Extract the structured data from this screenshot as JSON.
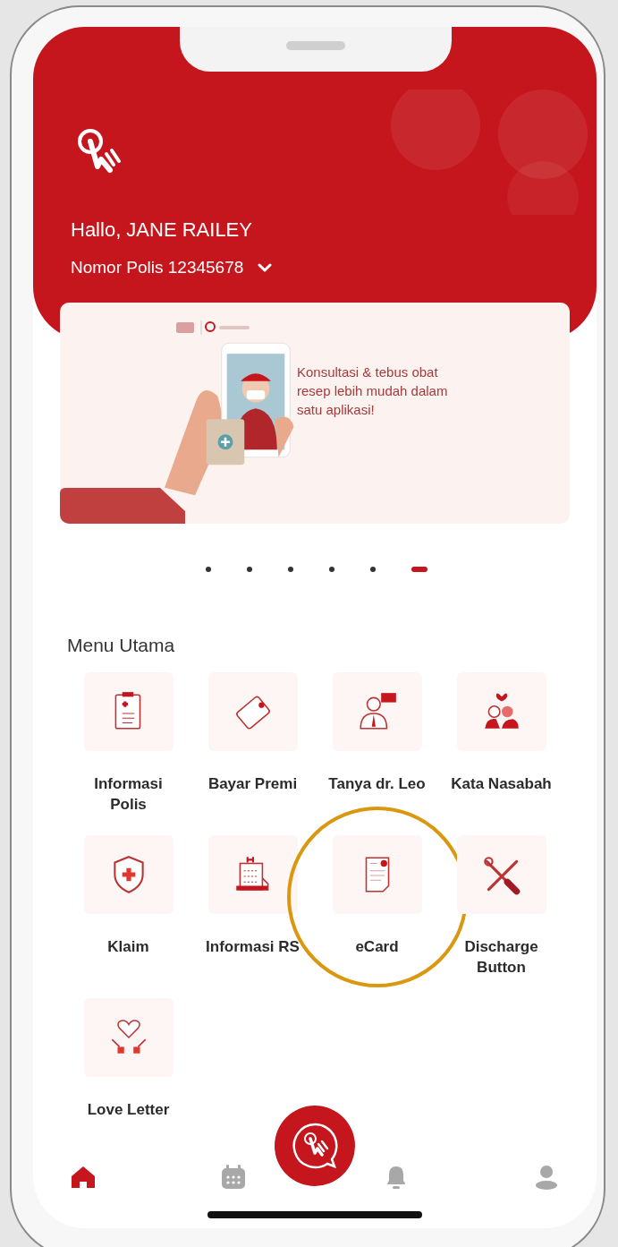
{
  "header": {
    "greeting": "Hallo, JANE RAILEY",
    "policy": "Nomor Polis 12345678"
  },
  "banner": {
    "headline": "Konsultasi & tebus obat resep lebih mudah dalam satu aplikasi!"
  },
  "carousel": {
    "dots": [
      {
        "selected": false
      },
      {
        "selected": false
      },
      {
        "selected": false
      },
      {
        "selected": false
      },
      {
        "selected": false
      },
      {
        "selected": true
      }
    ]
  },
  "menu": {
    "title": "Menu Utama",
    "items": [
      {
        "label": "Informasi Polis",
        "highlighted": false
      },
      {
        "label": "Bayar Premi",
        "highlighted": false
      },
      {
        "label": "Tanya dr. Leo",
        "highlighted": false
      },
      {
        "label": "Kata Nasabah",
        "highlighted": false
      },
      {
        "label": "Klaim",
        "highlighted": false
      },
      {
        "label": "Informasi RS",
        "highlighted": false
      },
      {
        "label": "eCard",
        "highlighted": true
      },
      {
        "label": "Discharge Button",
        "highlighted": false
      },
      {
        "label": "Love Letter",
        "highlighted": false
      }
    ]
  },
  "bottom_nav": [
    {
      "selected": true
    },
    {
      "selected": false
    },
    {
      "selected": false
    },
    {
      "selected": false
    }
  ]
}
